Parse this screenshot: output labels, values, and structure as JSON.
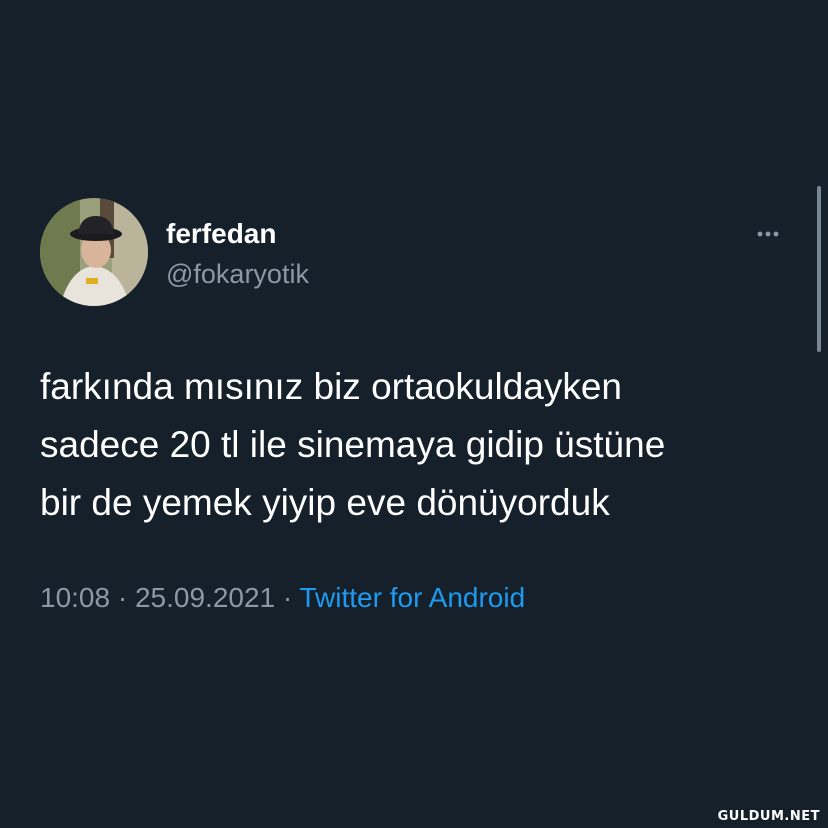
{
  "author": {
    "display_name": "ferfedan",
    "handle": "@fokaryotik"
  },
  "tweet": {
    "lines": [
      "farkında mısınız biz ortaokuldayken",
      "sadece 20 tl ile sinemaya gidip üstüne",
      "bir de yemek yiyip eve dönüyorduk"
    ],
    "time": "10:08",
    "separator": "·",
    "date": "25.09.2021",
    "source": "Twitter for Android"
  },
  "icons": {
    "more": "more-horizontal-icon"
  },
  "colors": {
    "background": "#15202b",
    "text": "#ffffff",
    "secondary": "#8b98a5",
    "link": "#1d9bf0"
  },
  "watermark": "GULDUM.NET"
}
